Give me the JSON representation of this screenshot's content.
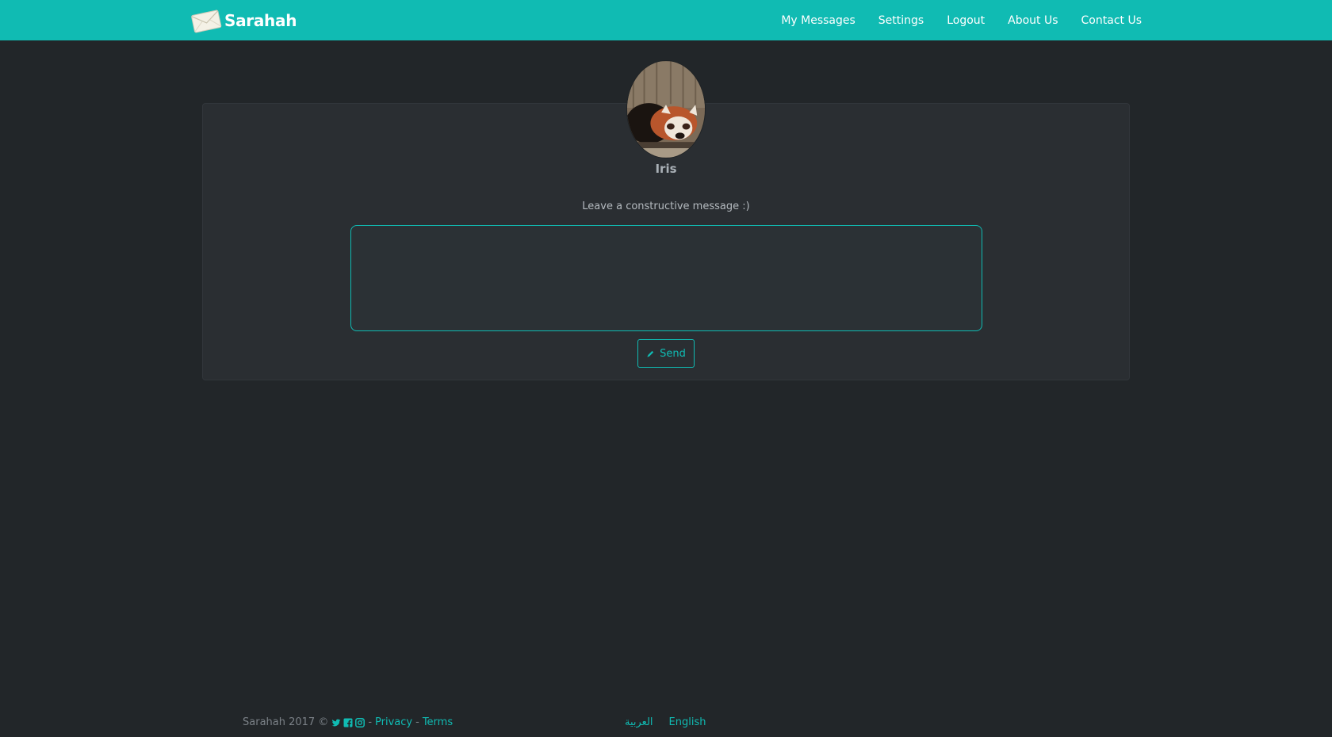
{
  "navbar": {
    "brand": "Sarahah",
    "links": [
      "My Messages",
      "Settings",
      "Logout",
      "About Us",
      "Contact Us"
    ]
  },
  "profile": {
    "name": "Iris",
    "prompt": "Leave a constructive message :)"
  },
  "form": {
    "message_value": "",
    "send_label": "Send"
  },
  "footer": {
    "copyright": "Sarahah 2017 ©",
    "separator": "-",
    "privacy": "Privacy",
    "terms": "Terms",
    "languages": [
      "العربية",
      "English"
    ]
  },
  "colors": {
    "accent": "#10bbb3",
    "background": "#222629",
    "panel": "#2a2e32"
  }
}
